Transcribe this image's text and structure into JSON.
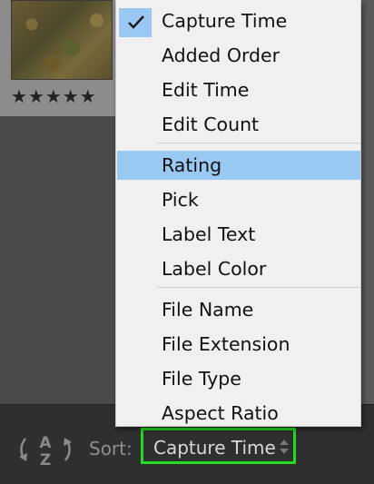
{
  "thumbnail": {
    "rating_stars": "★★★★★"
  },
  "menu": {
    "groups": [
      [
        {
          "label": "Capture Time",
          "checked": true
        },
        {
          "label": "Added Order"
        },
        {
          "label": "Edit Time"
        },
        {
          "label": "Edit Count"
        }
      ],
      [
        {
          "label": "Rating",
          "highlighted": true
        },
        {
          "label": "Pick"
        },
        {
          "label": "Label Text"
        },
        {
          "label": "Label Color"
        }
      ],
      [
        {
          "label": "File Name"
        },
        {
          "label": "File Extension"
        },
        {
          "label": "File Type"
        },
        {
          "label": "Aspect Ratio"
        }
      ]
    ],
    "highlight_color": "#99c9f3"
  },
  "toolbar": {
    "sort_label": "Sort:",
    "sort_value": "Capture Time",
    "sort_direction_icon": "az-sort-icon",
    "focus_outline_color": "#22dd22"
  }
}
